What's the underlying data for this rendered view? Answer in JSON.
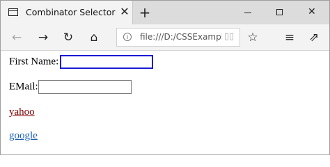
{
  "tab": {
    "title": "Combinator Selector",
    "close_glyph": "✕",
    "new_tab_glyph": "+"
  },
  "window_controls": {
    "close_glyph": "✕"
  },
  "toolbar": {
    "back_glyph": "←",
    "forward_glyph": "→",
    "refresh_glyph": "↻",
    "home_glyph": "⌂",
    "favorite_glyph": "☆",
    "favorites_list_glyph": "≡",
    "share_glyph": "⇗",
    "info_glyph": "i",
    "reader_glyph": "▯▯",
    "address_value": "file:///D:/CSSExample"
  },
  "form": {
    "first_name_label": "First Name:",
    "first_name_value": "",
    "email_label": "EMail:",
    "email_value": ""
  },
  "links": [
    {
      "text": "yahoo",
      "color": "#800000"
    },
    {
      "text": "google",
      "color": "#1a5fb4"
    }
  ]
}
